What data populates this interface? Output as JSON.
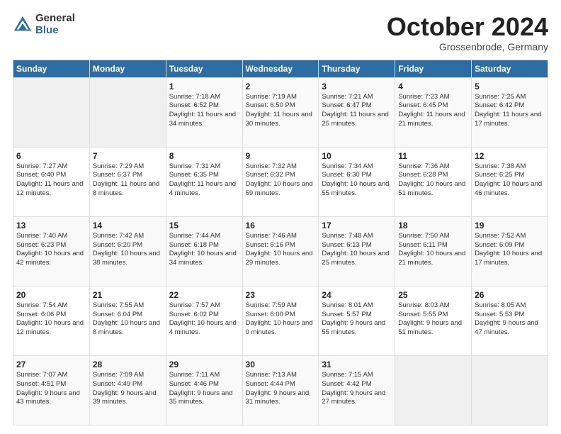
{
  "header": {
    "logo_general": "General",
    "logo_blue": "Blue",
    "month": "October 2024",
    "location": "Grossenbrode, Germany"
  },
  "days_header": [
    "Sunday",
    "Monday",
    "Tuesday",
    "Wednesday",
    "Thursday",
    "Friday",
    "Saturday"
  ],
  "weeks": [
    [
      {
        "day": "",
        "empty": true
      },
      {
        "day": "",
        "empty": true
      },
      {
        "day": "1",
        "sunrise": "7:18 AM",
        "sunset": "6:52 PM",
        "daylight": "11 hours and 34 minutes."
      },
      {
        "day": "2",
        "sunrise": "7:19 AM",
        "sunset": "6:50 PM",
        "daylight": "11 hours and 30 minutes."
      },
      {
        "day": "3",
        "sunrise": "7:21 AM",
        "sunset": "6:47 PM",
        "daylight": "11 hours and 25 minutes."
      },
      {
        "day": "4",
        "sunrise": "7:23 AM",
        "sunset": "6:45 PM",
        "daylight": "11 hours and 21 minutes."
      },
      {
        "day": "5",
        "sunrise": "7:25 AM",
        "sunset": "6:42 PM",
        "daylight": "11 hours and 17 minutes."
      }
    ],
    [
      {
        "day": "6",
        "sunrise": "7:27 AM",
        "sunset": "6:40 PM",
        "daylight": "11 hours and 12 minutes."
      },
      {
        "day": "7",
        "sunrise": "7:29 AM",
        "sunset": "6:37 PM",
        "daylight": "11 hours and 8 minutes."
      },
      {
        "day": "8",
        "sunrise": "7:31 AM",
        "sunset": "6:35 PM",
        "daylight": "11 hours and 4 minutes."
      },
      {
        "day": "9",
        "sunrise": "7:32 AM",
        "sunset": "6:32 PM",
        "daylight": "10 hours and 59 minutes."
      },
      {
        "day": "10",
        "sunrise": "7:34 AM",
        "sunset": "6:30 PM",
        "daylight": "10 hours and 55 minutes."
      },
      {
        "day": "11",
        "sunrise": "7:36 AM",
        "sunset": "6:28 PM",
        "daylight": "10 hours and 51 minutes."
      },
      {
        "day": "12",
        "sunrise": "7:38 AM",
        "sunset": "6:25 PM",
        "daylight": "10 hours and 46 minutes."
      }
    ],
    [
      {
        "day": "13",
        "sunrise": "7:40 AM",
        "sunset": "6:23 PM",
        "daylight": "10 hours and 42 minutes."
      },
      {
        "day": "14",
        "sunrise": "7:42 AM",
        "sunset": "6:20 PM",
        "daylight": "10 hours and 38 minutes."
      },
      {
        "day": "15",
        "sunrise": "7:44 AM",
        "sunset": "6:18 PM",
        "daylight": "10 hours and 34 minutes."
      },
      {
        "day": "16",
        "sunrise": "7:46 AM",
        "sunset": "6:16 PM",
        "daylight": "10 hours and 29 minutes."
      },
      {
        "day": "17",
        "sunrise": "7:48 AM",
        "sunset": "6:13 PM",
        "daylight": "10 hours and 25 minutes."
      },
      {
        "day": "18",
        "sunrise": "7:50 AM",
        "sunset": "6:11 PM",
        "daylight": "10 hours and 21 minutes."
      },
      {
        "day": "19",
        "sunrise": "7:52 AM",
        "sunset": "6:09 PM",
        "daylight": "10 hours and 17 minutes."
      }
    ],
    [
      {
        "day": "20",
        "sunrise": "7:54 AM",
        "sunset": "6:06 PM",
        "daylight": "10 hours and 12 minutes."
      },
      {
        "day": "21",
        "sunrise": "7:55 AM",
        "sunset": "6:04 PM",
        "daylight": "10 hours and 8 minutes."
      },
      {
        "day": "22",
        "sunrise": "7:57 AM",
        "sunset": "6:02 PM",
        "daylight": "10 hours and 4 minutes."
      },
      {
        "day": "23",
        "sunrise": "7:59 AM",
        "sunset": "6:00 PM",
        "daylight": "10 hours and 0 minutes."
      },
      {
        "day": "24",
        "sunrise": "8:01 AM",
        "sunset": "5:57 PM",
        "daylight": "9 hours and 55 minutes."
      },
      {
        "day": "25",
        "sunrise": "8:03 AM",
        "sunset": "5:55 PM",
        "daylight": "9 hours and 51 minutes."
      },
      {
        "day": "26",
        "sunrise": "8:05 AM",
        "sunset": "5:53 PM",
        "daylight": "9 hours and 47 minutes."
      }
    ],
    [
      {
        "day": "27",
        "sunrise": "7:07 AM",
        "sunset": "4:51 PM",
        "daylight": "9 hours and 43 minutes."
      },
      {
        "day": "28",
        "sunrise": "7:09 AM",
        "sunset": "4:49 PM",
        "daylight": "9 hours and 39 minutes."
      },
      {
        "day": "29",
        "sunrise": "7:11 AM",
        "sunset": "4:46 PM",
        "daylight": "9 hours and 35 minutes."
      },
      {
        "day": "30",
        "sunrise": "7:13 AM",
        "sunset": "4:44 PM",
        "daylight": "9 hours and 31 minutes."
      },
      {
        "day": "31",
        "sunrise": "7:15 AM",
        "sunset": "4:42 PM",
        "daylight": "9 hours and 27 minutes."
      },
      {
        "day": "",
        "empty": true
      },
      {
        "day": "",
        "empty": true
      }
    ]
  ]
}
